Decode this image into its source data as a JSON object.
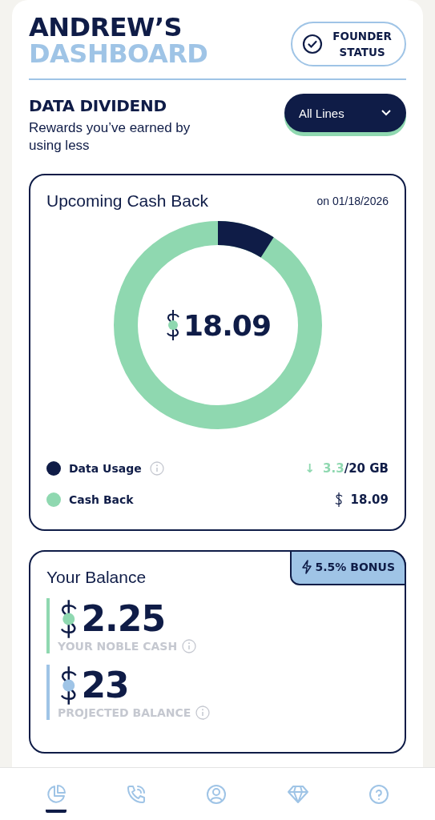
{
  "header": {
    "title_line_1": "ANDREW’S",
    "title_line_2": "DASHBOARD",
    "status_badge": [
      "FOUNDER",
      "STATUS"
    ]
  },
  "section": {
    "title": "DATA DIVIDEND",
    "subtitle": "Rewards you’ve earned by using less",
    "line_filter": "All Lines"
  },
  "cash_back_card": {
    "title": "Upcoming Cash Back",
    "date": "on 01/18/2026",
    "amount": "18.09",
    "legend": [
      {
        "label": "Data Usage",
        "color": "#0f1c47",
        "info": true,
        "trend": "↓",
        "used": "3.3",
        "total": "/20 GB"
      },
      {
        "label": "Cash Back",
        "color": "#8fd8b0",
        "info": false,
        "amount": "18.09"
      }
    ]
  },
  "balance_card": {
    "title": "Your Balance",
    "bonus": "5.5% BONUS",
    "items": [
      {
        "amount": "2.25",
        "label": "YOUR NOBLE CASH",
        "color": "#8fd8b0"
      },
      {
        "amount": "23",
        "label": "PROJECTED BALANCE",
        "color": "#9fc4e6"
      }
    ]
  },
  "tab_bar": [
    {
      "selected": true
    },
    {
      "selected": false
    },
    {
      "selected": false
    },
    {
      "selected": false
    },
    {
      "selected": false
    }
  ]
}
